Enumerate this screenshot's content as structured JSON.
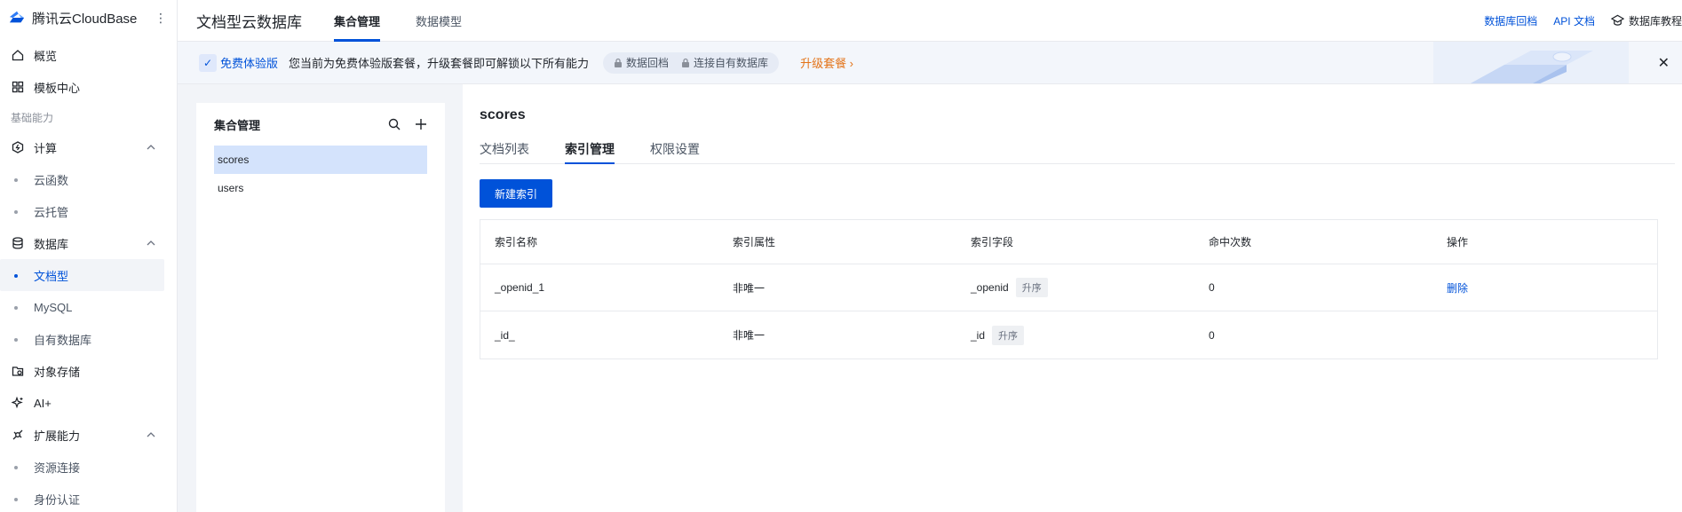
{
  "brand": {
    "name": "腾讯云CloudBase",
    "more": "⋮"
  },
  "sidebar": {
    "items": [
      {
        "type": "item",
        "label": "概览",
        "icon": "home-icon"
      },
      {
        "type": "item",
        "label": "模板中心",
        "icon": "grid-icon"
      },
      {
        "type": "section",
        "label": "基础能力"
      },
      {
        "type": "item",
        "label": "计算",
        "icon": "compute-icon",
        "expanded": true
      },
      {
        "type": "sub",
        "label": "云函数"
      },
      {
        "type": "sub",
        "label": "云托管"
      },
      {
        "type": "item",
        "label": "数据库",
        "icon": "database-icon",
        "expanded": true
      },
      {
        "type": "sub",
        "label": "文档型",
        "active": true
      },
      {
        "type": "sub",
        "label": "MySQL"
      },
      {
        "type": "sub",
        "label": "自有数据库"
      },
      {
        "type": "item",
        "label": "对象存储",
        "icon": "storage-icon"
      },
      {
        "type": "item",
        "label": "AI+",
        "icon": "sparkle-icon"
      },
      {
        "type": "item",
        "label": "扩展能力",
        "icon": "extension-icon",
        "expanded": true
      },
      {
        "type": "sub",
        "label": "资源连接"
      },
      {
        "type": "sub",
        "label": "身份认证"
      }
    ]
  },
  "header": {
    "title": "文档型云数据库",
    "tabs": [
      {
        "label": "集合管理",
        "active": true
      },
      {
        "label": "数据模型",
        "active": false
      }
    ],
    "links": {
      "backup": "数据库回档",
      "api_docs": "API 文档",
      "tutorial": "数据库教程"
    }
  },
  "banner": {
    "trial": "免费体验版",
    "text": "您当前为免费体验版套餐，升级套餐即可解锁以下所有能力",
    "features": [
      "数据回档",
      "连接自有数据库"
    ],
    "upgrade": "升级套餐 ›"
  },
  "collections": {
    "title": "集合管理",
    "items": [
      {
        "name": "scores",
        "active": true
      },
      {
        "name": "users",
        "active": false
      }
    ]
  },
  "detail": {
    "title": "scores",
    "tabs": [
      {
        "label": "文档列表",
        "active": false
      },
      {
        "label": "索引管理",
        "active": true
      },
      {
        "label": "权限设置",
        "active": false
      }
    ],
    "new_index_button": "新建索引",
    "table": {
      "headers": [
        "索引名称",
        "索引属性",
        "索引字段",
        "命中次数",
        "操作"
      ],
      "rows": [
        {
          "name": "_openid_1",
          "attr": "非唯一",
          "field": "_openid",
          "order": "升序",
          "hits": "0",
          "action": "删除"
        },
        {
          "name": "_id_",
          "attr": "非唯一",
          "field": "_id",
          "order": "升序",
          "hits": "0",
          "action": ""
        }
      ]
    }
  },
  "colors": {
    "primary": "#0052d9",
    "upgrade": "#e37318",
    "bg": "#f2f4f8"
  }
}
